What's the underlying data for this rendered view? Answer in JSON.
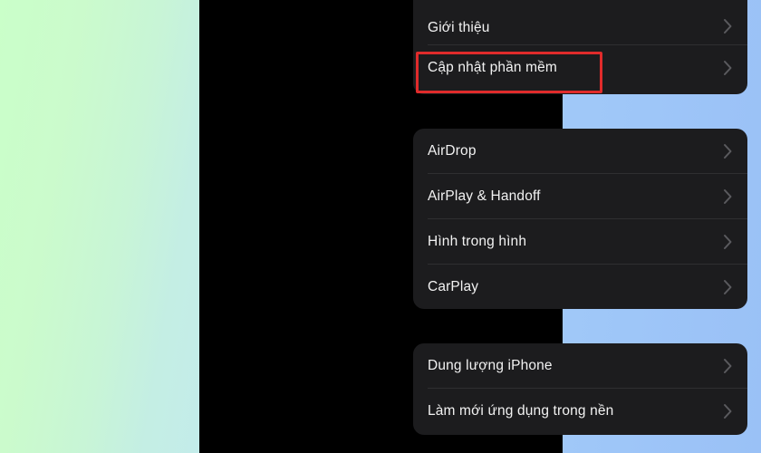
{
  "background": {
    "left_gradient_from": "#caffc9",
    "left_gradient_to": "#c3ecea",
    "right_gradient_from": "#a1c9f8",
    "right_gradient_to": "#9ac1f6",
    "screen_color": "#000000"
  },
  "theme": {
    "card_bg": "#1c1c1e",
    "label_color": "#f2f2f2",
    "chevron_color": "#5a5a5e",
    "divider_color": "#2f2f31",
    "highlight_color": "#e02b2b"
  },
  "annotation": {
    "highlight_target": "Cập nhật phần mềm"
  },
  "groups": [
    {
      "id": "group-general",
      "rows": [
        {
          "label": "Giới thiệu",
          "chevron": "chevron-right-icon",
          "highlighted": false
        },
        {
          "label": "Cập nhật phần mềm",
          "chevron": "chevron-right-icon",
          "highlighted": true
        }
      ]
    },
    {
      "id": "group-connectivity",
      "rows": [
        {
          "label": "AirDrop",
          "chevron": "chevron-right-icon",
          "highlighted": false
        },
        {
          "label": "AirPlay & Handoff",
          "chevron": "chevron-right-icon",
          "highlighted": false
        },
        {
          "label": "Hình trong hình",
          "chevron": "chevron-right-icon",
          "highlighted": false
        },
        {
          "label": "CarPlay",
          "chevron": "chevron-right-icon",
          "highlighted": false
        }
      ]
    },
    {
      "id": "group-storage",
      "rows": [
        {
          "label": "Dung lượng iPhone",
          "chevron": "chevron-right-icon",
          "highlighted": false
        },
        {
          "label": "Làm mới ứng dụng trong nền",
          "chevron": "chevron-right-icon",
          "highlighted": false
        }
      ]
    }
  ]
}
